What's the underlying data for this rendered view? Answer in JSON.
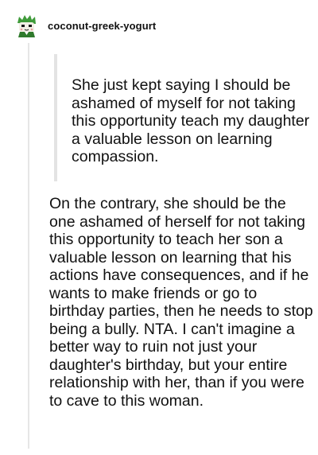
{
  "post": {
    "username": "coconut-greek-yogurt",
    "avatar_icon": "green-cartoon-character-avatar",
    "quote": "She just kept saying I should be ashamed of myself for not taking this opportunity teach my daughter a valuable lesson on learning compassion.",
    "reply": "On the contrary, she should be the one ashamed of herself for not taking this opportunity to teach her son a valuable lesson on learning that his actions have consequences, and if he wants to make friends or go to birthday parties, then he needs to stop being a bully. NTA. I can't imagine a better way to ruin not just your daughter's birthday, but your entire relationship with her, than if you were to cave to this woman."
  },
  "colors": {
    "text": "#111111",
    "thread_line": "#e6e6e6",
    "quote_border": "#e3e3e3",
    "avatar_green": "#3f9b3a"
  }
}
